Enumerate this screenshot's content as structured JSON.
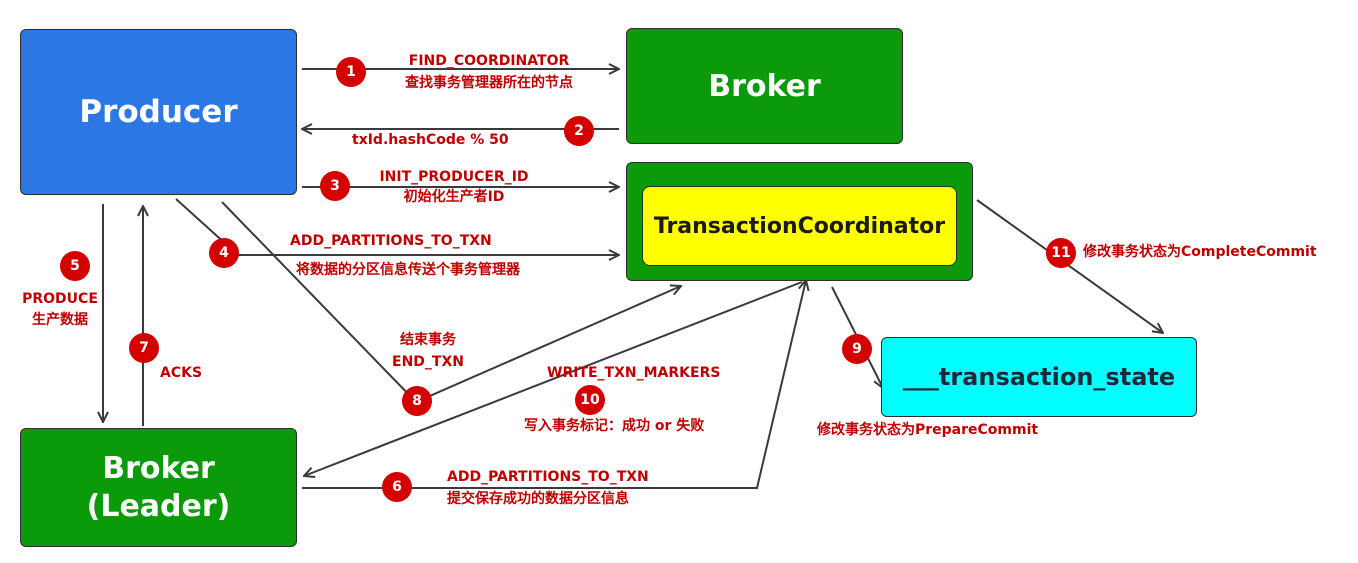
{
  "nodes": {
    "producer": "Producer",
    "broker": "Broker",
    "transaction_coordinator": "TransactionCoordinator",
    "transaction_state": "___transaction_state",
    "broker_leader_line1": "Broker",
    "broker_leader_line2": "(Leader)"
  },
  "steps": [
    {
      "num": "1",
      "label": "FIND_COORDINATOR",
      "desc": "查找事务管理器所在的节点"
    },
    {
      "num": "2",
      "label": "txId.hashCode % 50"
    },
    {
      "num": "3",
      "label": "INIT_PRODUCER_ID",
      "desc": "初始化生产者ID"
    },
    {
      "num": "4",
      "label": "ADD_PARTITIONS_TO_TXN",
      "desc": "将数据的分区信息传送个事务管理器"
    },
    {
      "num": "5",
      "label": "PRODUCE",
      "desc": "生产数据"
    },
    {
      "num": "6",
      "label": "ADD_PARTITIONS_TO_TXN",
      "desc": "提交保存成功的数据分区信息"
    },
    {
      "num": "7",
      "label": "ACKS"
    },
    {
      "num": "8",
      "label": "结束事务",
      "desc": "END_TXN"
    },
    {
      "num": "9",
      "label": "修改事务状态为PrepareCommit"
    },
    {
      "num": "10",
      "label": "WRITE_TXN_MARKERS",
      "desc": "写入事务标记：成功 or 失败"
    },
    {
      "num": "11",
      "label": "修改事务状态为CompleteCommit"
    }
  ],
  "colors": {
    "producer": "#2b78e4",
    "broker": "#0a9a0a",
    "coordinator": "#ffff00",
    "state": "#00ffff",
    "badge": "#d40000",
    "label": "#c00000",
    "arrow": "#3a3a3a"
  }
}
